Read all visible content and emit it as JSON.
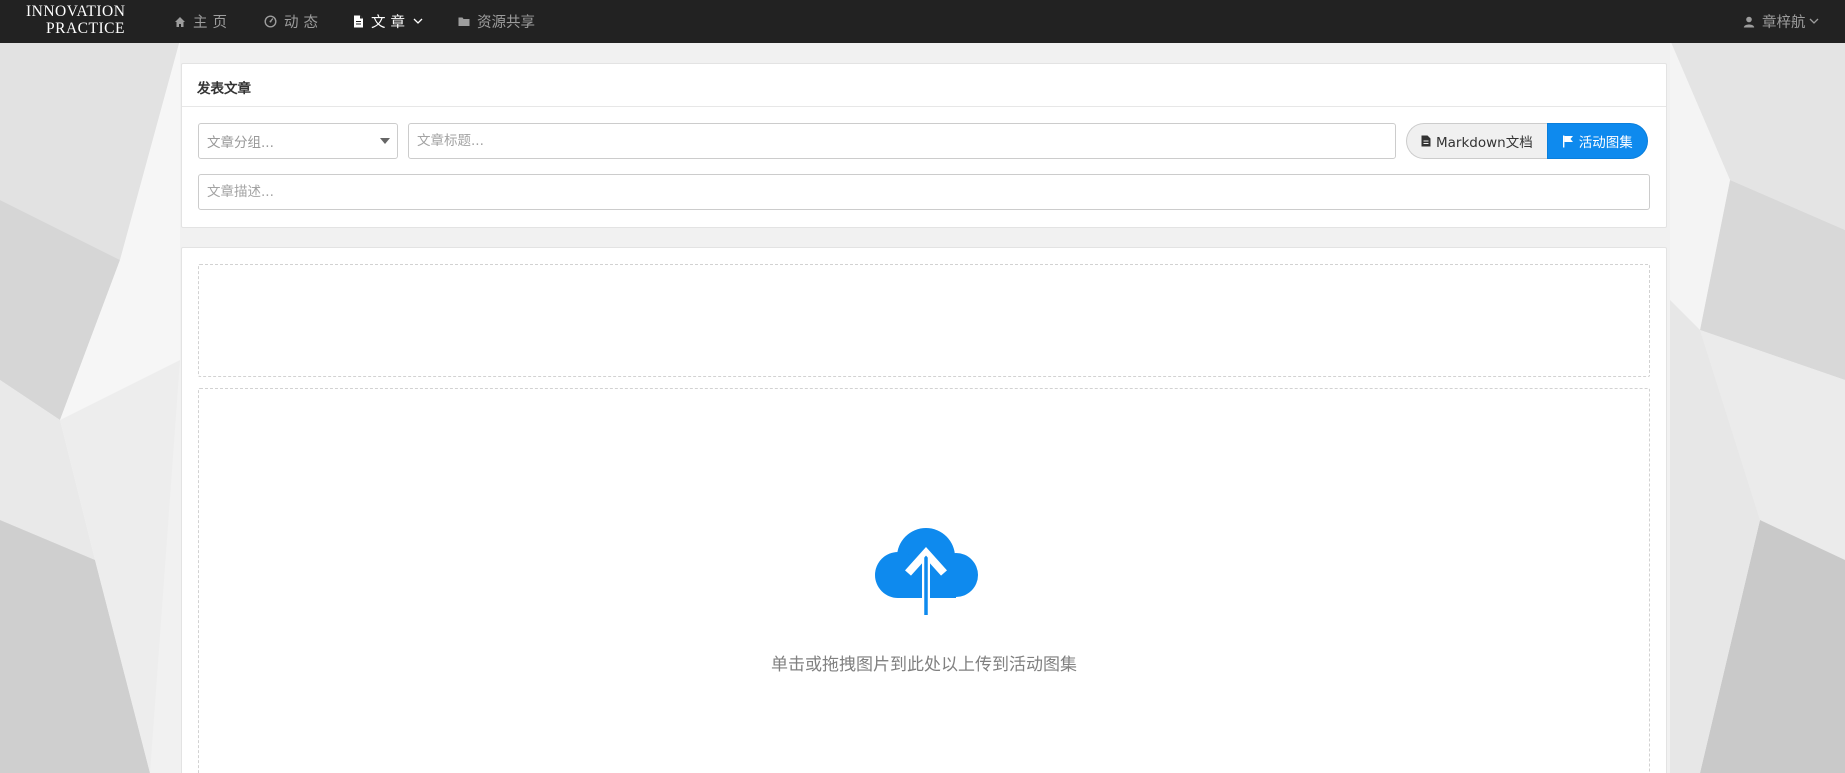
{
  "navbar": {
    "brand_line1": "INNOVATION",
    "brand_line2": "PRACTICE",
    "items": [
      {
        "label": "主页",
        "icon": "home-icon"
      },
      {
        "label": "动态",
        "icon": "dashboard-icon"
      },
      {
        "label": "文章",
        "icon": "file-icon",
        "active": true,
        "has_dropdown": true
      },
      {
        "label": "资源共享",
        "icon": "folder-icon"
      }
    ],
    "user": {
      "name": "章梓航",
      "icon": "user-icon"
    }
  },
  "publish_panel": {
    "title": "发表文章",
    "group_select_placeholder": "文章分组...",
    "title_input_placeholder": "文章标题...",
    "description_input_placeholder": "文章描述...",
    "type_buttons": [
      {
        "label": "Markdown文档",
        "icon": "file-icon",
        "selected": false
      },
      {
        "label": "活动图集",
        "icon": "flag-icon",
        "selected": true
      }
    ]
  },
  "upload_panel": {
    "upload_hint": "单击或拖拽图片到此处以上传到活动图集",
    "upload_icon": "cloud-upload-icon"
  },
  "colors": {
    "navbar_bg": "#222222",
    "accent": "#0e8aee",
    "cloud": "#0e8aee"
  }
}
